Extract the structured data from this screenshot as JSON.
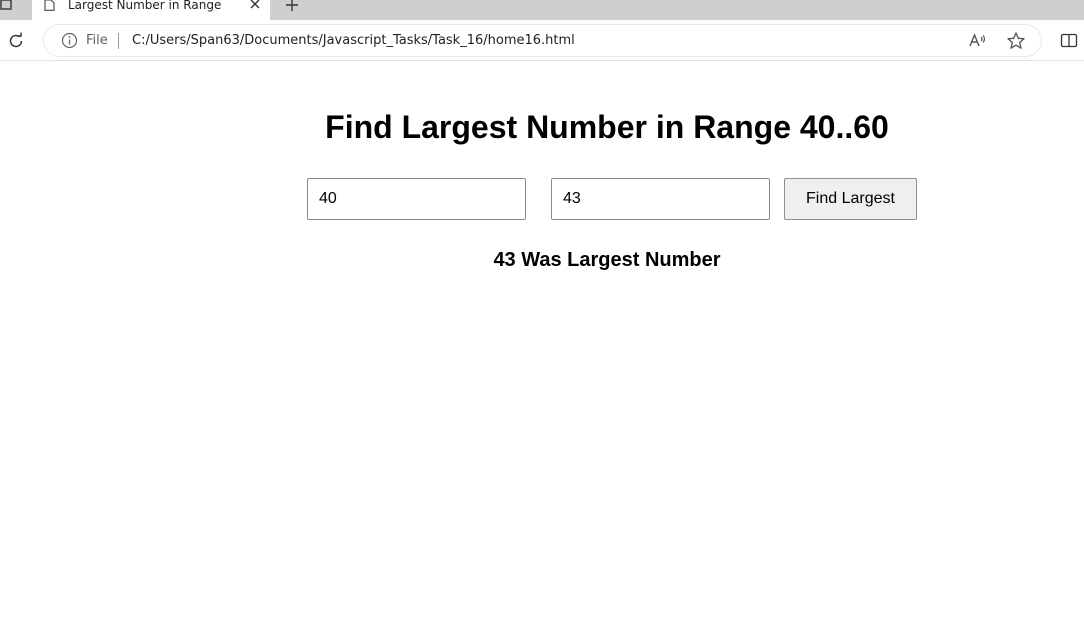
{
  "browser": {
    "tab": {
      "title": "Largest Number in Range"
    },
    "address_bar": {
      "scheme_label": "File",
      "url": "C:/Users/Span63/Documents/Javascript_Tasks/Task_16/home16.html"
    }
  },
  "page": {
    "heading": "Find Largest Number in Range 40..60",
    "inputs": {
      "first_value": "40",
      "second_value": "43"
    },
    "button_label": "Find Largest",
    "result": "43 Was Largest Number"
  }
}
